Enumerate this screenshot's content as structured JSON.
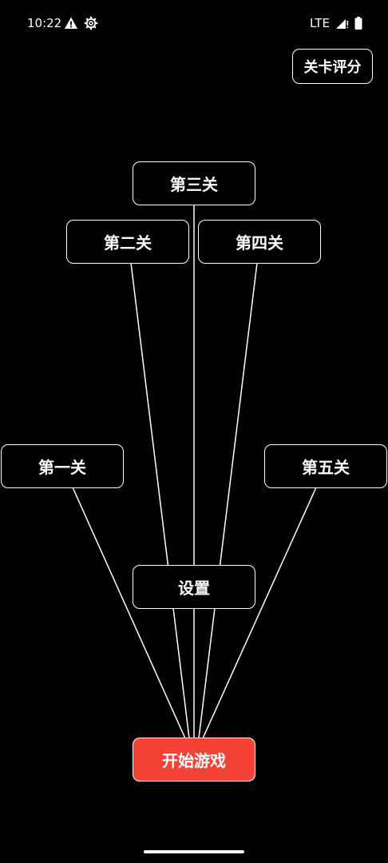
{
  "status_bar": {
    "time": "10:22",
    "network": "LTE",
    "icons": [
      "warning-icon",
      "gear-icon",
      "signal-icon",
      "battery-icon"
    ]
  },
  "header": {
    "rating_label": "关卡评分"
  },
  "level_map": {
    "levels": [
      {
        "id": 1,
        "label": "第一关"
      },
      {
        "id": 2,
        "label": "第二关"
      },
      {
        "id": 3,
        "label": "第三关"
      },
      {
        "id": 4,
        "label": "第四关"
      },
      {
        "id": 5,
        "label": "第五关"
      }
    ],
    "settings_label": "设置",
    "start_label": "开始游戏"
  },
  "colors": {
    "background": "#000000",
    "foreground": "#ffffff",
    "start_button": "#f44336"
  }
}
